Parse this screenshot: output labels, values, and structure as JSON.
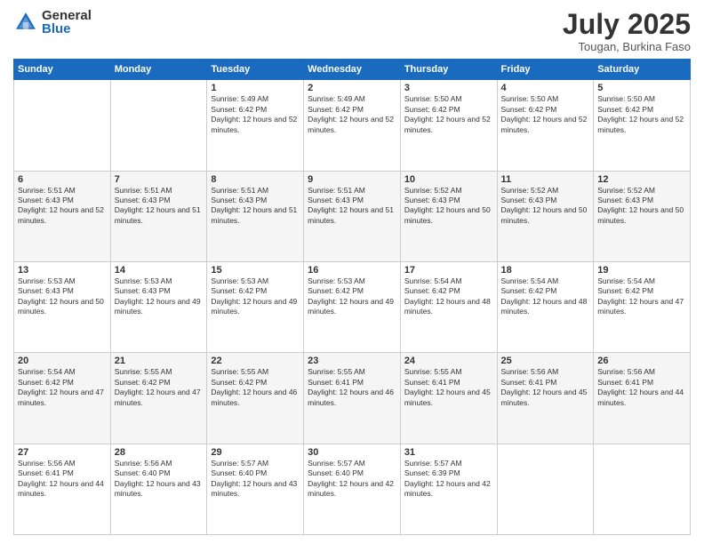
{
  "logo": {
    "general": "General",
    "blue": "Blue"
  },
  "title": "July 2025",
  "location": "Tougan, Burkina Faso",
  "days_of_week": [
    "Sunday",
    "Monday",
    "Tuesday",
    "Wednesday",
    "Thursday",
    "Friday",
    "Saturday"
  ],
  "weeks": [
    [
      {
        "day": "",
        "sunrise": "",
        "sunset": "",
        "daylight": ""
      },
      {
        "day": "",
        "sunrise": "",
        "sunset": "",
        "daylight": ""
      },
      {
        "day": "1",
        "sunrise": "Sunrise: 5:49 AM",
        "sunset": "Sunset: 6:42 PM",
        "daylight": "Daylight: 12 hours and 52 minutes."
      },
      {
        "day": "2",
        "sunrise": "Sunrise: 5:49 AM",
        "sunset": "Sunset: 6:42 PM",
        "daylight": "Daylight: 12 hours and 52 minutes."
      },
      {
        "day": "3",
        "sunrise": "Sunrise: 5:50 AM",
        "sunset": "Sunset: 6:42 PM",
        "daylight": "Daylight: 12 hours and 52 minutes."
      },
      {
        "day": "4",
        "sunrise": "Sunrise: 5:50 AM",
        "sunset": "Sunset: 6:42 PM",
        "daylight": "Daylight: 12 hours and 52 minutes."
      },
      {
        "day": "5",
        "sunrise": "Sunrise: 5:50 AM",
        "sunset": "Sunset: 6:42 PM",
        "daylight": "Daylight: 12 hours and 52 minutes."
      }
    ],
    [
      {
        "day": "6",
        "sunrise": "Sunrise: 5:51 AM",
        "sunset": "Sunset: 6:43 PM",
        "daylight": "Daylight: 12 hours and 52 minutes."
      },
      {
        "day": "7",
        "sunrise": "Sunrise: 5:51 AM",
        "sunset": "Sunset: 6:43 PM",
        "daylight": "Daylight: 12 hours and 51 minutes."
      },
      {
        "day": "8",
        "sunrise": "Sunrise: 5:51 AM",
        "sunset": "Sunset: 6:43 PM",
        "daylight": "Daylight: 12 hours and 51 minutes."
      },
      {
        "day": "9",
        "sunrise": "Sunrise: 5:51 AM",
        "sunset": "Sunset: 6:43 PM",
        "daylight": "Daylight: 12 hours and 51 minutes."
      },
      {
        "day": "10",
        "sunrise": "Sunrise: 5:52 AM",
        "sunset": "Sunset: 6:43 PM",
        "daylight": "Daylight: 12 hours and 50 minutes."
      },
      {
        "day": "11",
        "sunrise": "Sunrise: 5:52 AM",
        "sunset": "Sunset: 6:43 PM",
        "daylight": "Daylight: 12 hours and 50 minutes."
      },
      {
        "day": "12",
        "sunrise": "Sunrise: 5:52 AM",
        "sunset": "Sunset: 6:43 PM",
        "daylight": "Daylight: 12 hours and 50 minutes."
      }
    ],
    [
      {
        "day": "13",
        "sunrise": "Sunrise: 5:53 AM",
        "sunset": "Sunset: 6:43 PM",
        "daylight": "Daylight: 12 hours and 50 minutes."
      },
      {
        "day": "14",
        "sunrise": "Sunrise: 5:53 AM",
        "sunset": "Sunset: 6:43 PM",
        "daylight": "Daylight: 12 hours and 49 minutes."
      },
      {
        "day": "15",
        "sunrise": "Sunrise: 5:53 AM",
        "sunset": "Sunset: 6:42 PM",
        "daylight": "Daylight: 12 hours and 49 minutes."
      },
      {
        "day": "16",
        "sunrise": "Sunrise: 5:53 AM",
        "sunset": "Sunset: 6:42 PM",
        "daylight": "Daylight: 12 hours and 49 minutes."
      },
      {
        "day": "17",
        "sunrise": "Sunrise: 5:54 AM",
        "sunset": "Sunset: 6:42 PM",
        "daylight": "Daylight: 12 hours and 48 minutes."
      },
      {
        "day": "18",
        "sunrise": "Sunrise: 5:54 AM",
        "sunset": "Sunset: 6:42 PM",
        "daylight": "Daylight: 12 hours and 48 minutes."
      },
      {
        "day": "19",
        "sunrise": "Sunrise: 5:54 AM",
        "sunset": "Sunset: 6:42 PM",
        "daylight": "Daylight: 12 hours and 47 minutes."
      }
    ],
    [
      {
        "day": "20",
        "sunrise": "Sunrise: 5:54 AM",
        "sunset": "Sunset: 6:42 PM",
        "daylight": "Daylight: 12 hours and 47 minutes."
      },
      {
        "day": "21",
        "sunrise": "Sunrise: 5:55 AM",
        "sunset": "Sunset: 6:42 PM",
        "daylight": "Daylight: 12 hours and 47 minutes."
      },
      {
        "day": "22",
        "sunrise": "Sunrise: 5:55 AM",
        "sunset": "Sunset: 6:42 PM",
        "daylight": "Daylight: 12 hours and 46 minutes."
      },
      {
        "day": "23",
        "sunrise": "Sunrise: 5:55 AM",
        "sunset": "Sunset: 6:41 PM",
        "daylight": "Daylight: 12 hours and 46 minutes."
      },
      {
        "day": "24",
        "sunrise": "Sunrise: 5:55 AM",
        "sunset": "Sunset: 6:41 PM",
        "daylight": "Daylight: 12 hours and 45 minutes."
      },
      {
        "day": "25",
        "sunrise": "Sunrise: 5:56 AM",
        "sunset": "Sunset: 6:41 PM",
        "daylight": "Daylight: 12 hours and 45 minutes."
      },
      {
        "day": "26",
        "sunrise": "Sunrise: 5:56 AM",
        "sunset": "Sunset: 6:41 PM",
        "daylight": "Daylight: 12 hours and 44 minutes."
      }
    ],
    [
      {
        "day": "27",
        "sunrise": "Sunrise: 5:56 AM",
        "sunset": "Sunset: 6:41 PM",
        "daylight": "Daylight: 12 hours and 44 minutes."
      },
      {
        "day": "28",
        "sunrise": "Sunrise: 5:56 AM",
        "sunset": "Sunset: 6:40 PM",
        "daylight": "Daylight: 12 hours and 43 minutes."
      },
      {
        "day": "29",
        "sunrise": "Sunrise: 5:57 AM",
        "sunset": "Sunset: 6:40 PM",
        "daylight": "Daylight: 12 hours and 43 minutes."
      },
      {
        "day": "30",
        "sunrise": "Sunrise: 5:57 AM",
        "sunset": "Sunset: 6:40 PM",
        "daylight": "Daylight: 12 hours and 42 minutes."
      },
      {
        "day": "31",
        "sunrise": "Sunrise: 5:57 AM",
        "sunset": "Sunset: 6:39 PM",
        "daylight": "Daylight: 12 hours and 42 minutes."
      },
      {
        "day": "",
        "sunrise": "",
        "sunset": "",
        "daylight": ""
      },
      {
        "day": "",
        "sunrise": "",
        "sunset": "",
        "daylight": ""
      }
    ]
  ]
}
